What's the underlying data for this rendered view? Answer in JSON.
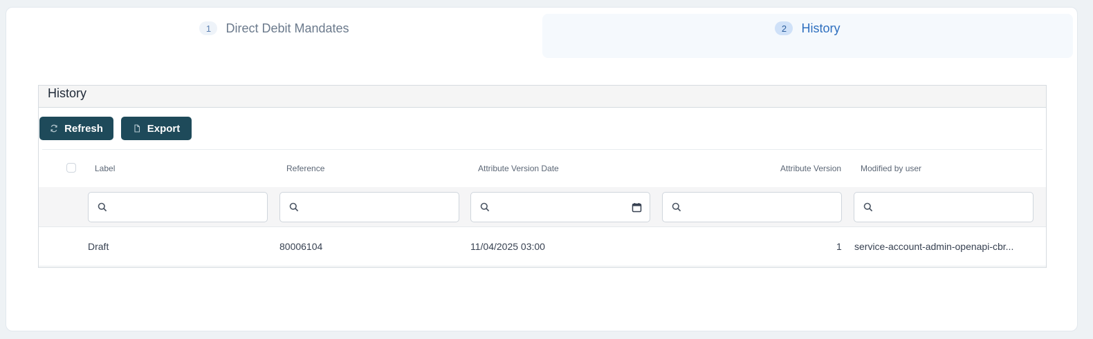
{
  "steps": [
    {
      "number": "1",
      "label": "Direct Debit Mandates"
    },
    {
      "number": "2",
      "label": "History"
    }
  ],
  "panel": {
    "title": "History"
  },
  "toolbar": {
    "refresh_label": "Refresh",
    "export_label": "Export"
  },
  "table": {
    "columns": [
      "Label",
      "Reference",
      "Attribute Version Date",
      "Attribute Version",
      "Modified by user"
    ],
    "filters": [
      {
        "placeholder": ""
      },
      {
        "placeholder": ""
      },
      {
        "placeholder": ""
      },
      {
        "placeholder": ""
      },
      {
        "placeholder": ""
      }
    ],
    "rows": [
      [
        "Draft",
        "80006104",
        "11/04/2025 03:00",
        "1",
        "service-account-admin-openapi-cbr..."
      ]
    ]
  },
  "colors": {
    "accent": "#1e4a5a",
    "active_step": "#2e6fbf"
  },
  "icons": {
    "refresh": "refresh-icon",
    "export": "file-icon",
    "search": "search-icon",
    "calendar": "calendar-icon"
  }
}
